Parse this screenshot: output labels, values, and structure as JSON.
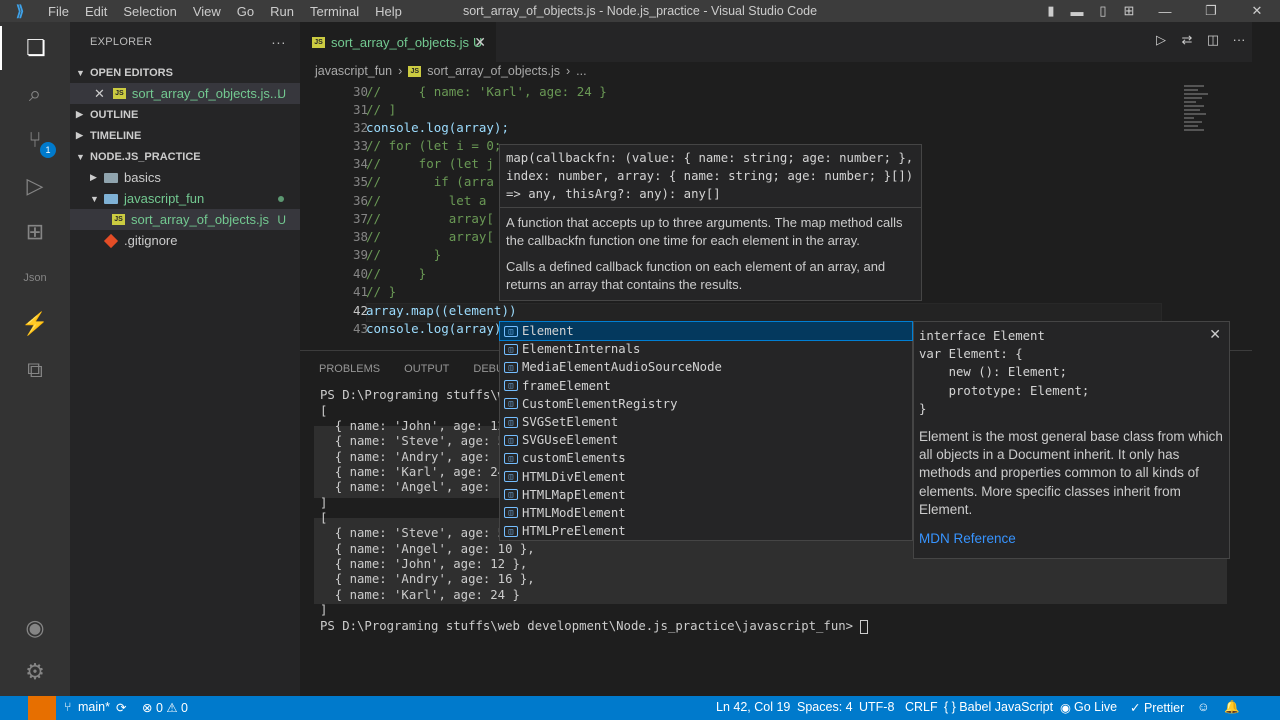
{
  "titlebar": {
    "logo": "⟫",
    "menu": [
      "File",
      "Edit",
      "Selection",
      "View",
      "Go",
      "Run",
      "Terminal",
      "Help"
    ],
    "title": "sort_array_of_objects.js - Node.js_practice - Visual Studio Code"
  },
  "sidebar": {
    "title": "EXPLORER",
    "open_editors": "OPEN EDITORS",
    "open_file": "sort_array_of_objects.js...",
    "open_file_status": "U",
    "outline": "OUTLINE",
    "timeline": "TIMELINE",
    "project": "NODE.JS_PRACTICE",
    "folders": [
      "basics",
      "javascript_fun"
    ],
    "file": "sort_array_of_objects.js",
    "file_status": "U",
    "gitignore": ".gitignore",
    "badge": "1"
  },
  "editor": {
    "tab_label": "sort_array_of_objects.js",
    "tab_status": "U",
    "breadcrumb": [
      "javascript_fun",
      "sort_array_of_objects.js",
      "..."
    ],
    "lines": [
      {
        "n": "30",
        "text": "//     { name: 'Karl', age: 24 }"
      },
      {
        "n": "31",
        "text": "// ]"
      },
      {
        "n": "32",
        "text": "console.log(array);"
      },
      {
        "n": "33",
        "text": "// for (let i = 0;"
      },
      {
        "n": "34",
        "text": "//     for (let j"
      },
      {
        "n": "35",
        "text": "//       if (arra"
      },
      {
        "n": "36",
        "text": "//         let a"
      },
      {
        "n": "37",
        "text": "//         array["
      },
      {
        "n": "38",
        "text": "//         array["
      },
      {
        "n": "39",
        "text": "//       }"
      },
      {
        "n": "40",
        "text": "//     }"
      },
      {
        "n": "41",
        "text": "// }"
      },
      {
        "n": "42",
        "text": "array.map((element))"
      },
      {
        "n": "43",
        "text": "console.log(array)"
      }
    ]
  },
  "hover": {
    "sig": "map(callbackfn: (value: { name: string; age: number; },\nindex: number, array: { name: string; age: number; }[])\n=> any, thisArg?: any): any[]",
    "doc1": "A function that accepts up to three arguments. The map method calls the callbackfn function one time for each element in the array.",
    "doc2": "Calls a defined callback function on each element of an array, and returns an array that contains the results."
  },
  "suggest": {
    "items": [
      "Element",
      "ElementInternals",
      "MediaElementAudioSourceNode",
      "frameElement",
      "CustomElementRegistry",
      "SVGSetElement",
      "SVGUseElement",
      "customElements",
      "HTMLDivElement",
      "HTMLMapElement",
      "HTMLModElement",
      "HTMLPreElement"
    ]
  },
  "details": {
    "sig": "interface Element\nvar Element: {\n    new (): Element;\n    prototype: Element;\n}",
    "doc": "Element is the most general base class from which all objects in a Document inherit. It only has methods and properties common to all kinds of elements. More specific classes inherit from Element.",
    "link": "MDN Reference"
  },
  "panel": {
    "tabs": [
      "PROBLEMS",
      "OUTPUT",
      "DEBUG C"
    ],
    "lines": [
      "PS D:\\Programing stuffs\\web",
      "[",
      "  { name: 'John', age: 12",
      "  { name: 'Steve', age: 5",
      "  { name: 'Andry', age: 16",
      "  { name: 'Karl', age: 24",
      "  { name: 'Angel', age: 10",
      "]",
      "[",
      "  { name: 'Steve', age: 5",
      "  { name: 'Angel', age: 10 },",
      "  { name: 'John', age: 12 },",
      "  { name: 'Andry', age: 16 },",
      "  { name: 'Karl', age: 24 }",
      "]",
      "PS D:\\Programing stuffs\\web development\\Node.js_practice\\javascript_fun> "
    ]
  },
  "statusbar": {
    "branch": "main*",
    "problems": "⊗ 0 ⚠ 0",
    "position": "Ln 42, Col 19",
    "spaces": "Spaces: 4",
    "encoding": "UTF-8",
    "eol": "CRLF",
    "language": "{ } Babel JavaScript",
    "golive": "Go Live",
    "prettier": "✓ Prettier"
  },
  "colors": {
    "statusbar": "#007acc",
    "accent_green": "#73c991"
  }
}
